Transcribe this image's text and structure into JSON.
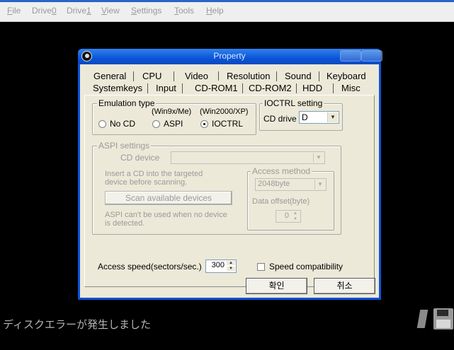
{
  "menu": [
    "File",
    "Drive0",
    "Drive1",
    "View",
    "Settings",
    "Tools",
    "Help"
  ],
  "menu_underline": [
    "F",
    "0",
    "1",
    "V",
    "S",
    "T",
    "H"
  ],
  "dialog": {
    "title": "Property",
    "tabs_row1": [
      "General",
      "CPU",
      "Video",
      "Resolution",
      "Sound",
      "Keyboard"
    ],
    "tabs_row2": [
      "Systemkeys",
      "Input",
      "CD-ROM1",
      "CD-ROM2",
      "HDD",
      "Misc"
    ],
    "active_tab": "CD-ROM1",
    "emulation": {
      "legend": "Emulation type",
      "hint_win9x": "(Win9x/Me)",
      "hint_win2000": "(Win2000/XP)",
      "options": [
        "No CD",
        "ASPI",
        "IOCTRL"
      ],
      "selected": "IOCTRL"
    },
    "ioctrl": {
      "legend": "IOCTRL setting",
      "drive_label": "CD drive",
      "drive_value": "D"
    },
    "aspi": {
      "legend": "ASPI settings",
      "device_label": "CD device",
      "device_value": "",
      "insert_hint_1": "Insert a CD into the targeted",
      "insert_hint_2": "device before scanning.",
      "scan_button": "Scan available devices",
      "warn_1": "ASPI can't be used when no device",
      "warn_2": "is detected.",
      "access_legend": "Access method",
      "access_value": "2048byte",
      "offset_label": "Data offset(byte)",
      "offset_value": "0"
    },
    "speed_label": "Access speed(sectors/sec.)",
    "speed_value": "300",
    "speed_compat_label": "Speed compatibility",
    "ok_button": "확인",
    "cancel_button": "취소"
  },
  "status_text": "ディスクエラーが発生しました",
  "colors": {
    "titlebar": "#0b55d8",
    "dialog_bg": "#ece9d8",
    "desktop": "#000000",
    "menubar": "#efefef"
  }
}
